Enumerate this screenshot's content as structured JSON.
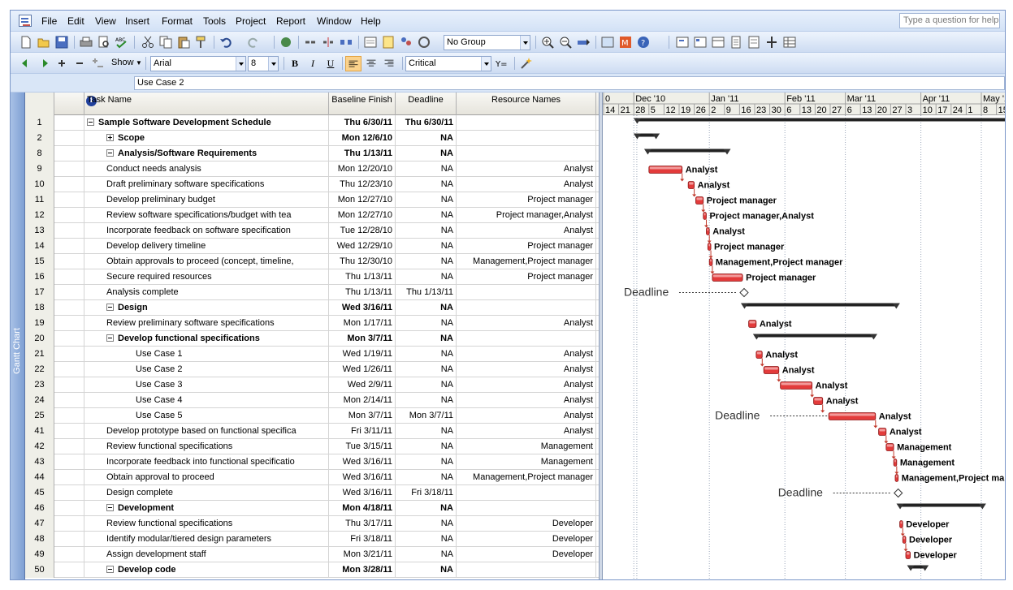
{
  "menu": [
    "File",
    "Edit",
    "View",
    "Insert",
    "Format",
    "Tools",
    "Project",
    "Report",
    "Window",
    "Help"
  ],
  "help_placeholder": "Type a question for help",
  "toolbar1": {
    "group_value": "No Group"
  },
  "toolbar2": {
    "show_label": "Show",
    "font": "Arial",
    "size": "8",
    "bold": "B",
    "italic": "I",
    "underline": "U",
    "filter": "Critical"
  },
  "entry_value": "Use Case 2",
  "view_label": "Gantt Chart",
  "columns": {
    "task_name": "Task Name",
    "baseline_finish": "Baseline Finish",
    "deadline": "Deadline",
    "resource_names": "Resource Names"
  },
  "tasks": [
    {
      "id": "1",
      "name": "Sample Software Development Schedule",
      "baseline": "Thu 6/30/11",
      "deadline": "Thu 6/30/11",
      "resources": "",
      "level": 0,
      "summary": true,
      "toggle": "minus"
    },
    {
      "id": "2",
      "name": "Scope",
      "baseline": "Mon 12/6/10",
      "deadline": "NA",
      "resources": "",
      "level": 1,
      "summary": true,
      "toggle": "plus"
    },
    {
      "id": "8",
      "name": "Analysis/Software Requirements",
      "baseline": "Thu 1/13/11",
      "deadline": "NA",
      "resources": "",
      "level": 1,
      "summary": true,
      "toggle": "minus"
    },
    {
      "id": "9",
      "name": "Conduct needs analysis",
      "baseline": "Mon 12/20/10",
      "deadline": "NA",
      "resources": "Analyst",
      "level": 2,
      "summary": false
    },
    {
      "id": "10",
      "name": "Draft preliminary software specifications",
      "baseline": "Thu 12/23/10",
      "deadline": "NA",
      "resources": "Analyst",
      "level": 2,
      "summary": false
    },
    {
      "id": "11",
      "name": "Develop preliminary budget",
      "baseline": "Mon 12/27/10",
      "deadline": "NA",
      "resources": "Project manager",
      "level": 2,
      "summary": false
    },
    {
      "id": "12",
      "name": "Review software specifications/budget with tea",
      "baseline": "Mon 12/27/10",
      "deadline": "NA",
      "resources": "Project manager,Analyst",
      "level": 2,
      "summary": false
    },
    {
      "id": "13",
      "name": "Incorporate feedback on software specification",
      "baseline": "Tue 12/28/10",
      "deadline": "NA",
      "resources": "Analyst",
      "level": 2,
      "summary": false
    },
    {
      "id": "14",
      "name": "Develop delivery timeline",
      "baseline": "Wed 12/29/10",
      "deadline": "NA",
      "resources": "Project manager",
      "level": 2,
      "summary": false
    },
    {
      "id": "15",
      "name": "Obtain approvals to proceed (concept, timeline,",
      "baseline": "Thu 12/30/10",
      "deadline": "NA",
      "resources": "Management,Project manager",
      "level": 2,
      "summary": false
    },
    {
      "id": "16",
      "name": "Secure required resources",
      "baseline": "Thu 1/13/11",
      "deadline": "NA",
      "resources": "Project manager",
      "level": 2,
      "summary": false
    },
    {
      "id": "17",
      "name": "Analysis complete",
      "baseline": "Thu 1/13/11",
      "deadline": "Thu 1/13/11",
      "resources": "",
      "level": 2,
      "summary": false
    },
    {
      "id": "18",
      "name": "Design",
      "baseline": "Wed 3/16/11",
      "deadline": "NA",
      "resources": "",
      "level": 1,
      "summary": true,
      "toggle": "minus"
    },
    {
      "id": "19",
      "name": "Review preliminary software specifications",
      "baseline": "Mon 1/17/11",
      "deadline": "NA",
      "resources": "Analyst",
      "level": 2,
      "summary": false
    },
    {
      "id": "20",
      "name": "Develop functional specifications",
      "baseline": "Mon 3/7/11",
      "deadline": "NA",
      "resources": "",
      "level": 2,
      "summary": true,
      "toggle": "minus"
    },
    {
      "id": "21",
      "name": "Use Case 1",
      "baseline": "Wed 1/19/11",
      "deadline": "NA",
      "resources": "Analyst",
      "level": 3,
      "summary": false
    },
    {
      "id": "22",
      "name": "Use Case 2",
      "baseline": "Wed 1/26/11",
      "deadline": "NA",
      "resources": "Analyst",
      "level": 3,
      "summary": false
    },
    {
      "id": "23",
      "name": "Use Case 3",
      "baseline": "Wed 2/9/11",
      "deadline": "NA",
      "resources": "Analyst",
      "level": 3,
      "summary": false
    },
    {
      "id": "24",
      "name": "Use Case 4",
      "baseline": "Mon 2/14/11",
      "deadline": "NA",
      "resources": "Analyst",
      "level": 3,
      "summary": false
    },
    {
      "id": "25",
      "name": "Use Case 5",
      "baseline": "Mon 3/7/11",
      "deadline": "Mon 3/7/11",
      "resources": "Analyst",
      "level": 3,
      "summary": false
    },
    {
      "id": "41",
      "name": "Develop prototype based on functional specifica",
      "baseline": "Fri 3/11/11",
      "deadline": "NA",
      "resources": "Analyst",
      "level": 2,
      "summary": false
    },
    {
      "id": "42",
      "name": "Review functional specifications",
      "baseline": "Tue 3/15/11",
      "deadline": "NA",
      "resources": "Management",
      "level": 2,
      "summary": false
    },
    {
      "id": "43",
      "name": "Incorporate feedback into functional specificatio",
      "baseline": "Wed 3/16/11",
      "deadline": "NA",
      "resources": "Management",
      "level": 2,
      "summary": false
    },
    {
      "id": "44",
      "name": "Obtain approval to proceed",
      "baseline": "Wed 3/16/11",
      "deadline": "NA",
      "resources": "Management,Project manager",
      "level": 2,
      "summary": false
    },
    {
      "id": "45",
      "name": "Design complete",
      "baseline": "Wed 3/16/11",
      "deadline": "Fri 3/18/11",
      "resources": "",
      "level": 2,
      "summary": false
    },
    {
      "id": "46",
      "name": "Development",
      "baseline": "Mon 4/18/11",
      "deadline": "NA",
      "resources": "",
      "level": 1,
      "summary": true,
      "toggle": "minus"
    },
    {
      "id": "47",
      "name": "Review functional specifications",
      "baseline": "Thu 3/17/11",
      "deadline": "NA",
      "resources": "Developer",
      "level": 2,
      "summary": false
    },
    {
      "id": "48",
      "name": "Identify modular/tiered design parameters",
      "baseline": "Fri 3/18/11",
      "deadline": "NA",
      "resources": "Developer",
      "level": 2,
      "summary": false
    },
    {
      "id": "49",
      "name": "Assign development staff",
      "baseline": "Mon 3/21/11",
      "deadline": "NA",
      "resources": "Developer",
      "level": 2,
      "summary": false
    },
    {
      "id": "50",
      "name": "Develop code",
      "baseline": "Mon 3/28/11",
      "deadline": "NA",
      "resources": "",
      "level": 2,
      "summary": true,
      "toggle": "minus"
    }
  ],
  "timescale": {
    "months": [
      {
        "label": "0",
        "week_index": 0
      },
      {
        "label": "Dec '10",
        "week_index": 2
      },
      {
        "label": "Jan '11",
        "week_index": 7
      },
      {
        "label": "Feb '11",
        "week_index": 12
      },
      {
        "label": "Mar '11",
        "week_index": 16
      },
      {
        "label": "Apr '11",
        "week_index": 21
      },
      {
        "label": "May '11",
        "week_index": 25
      }
    ],
    "days": [
      "14",
      "21",
      "28",
      "5",
      "12",
      "19",
      "26",
      "2",
      "9",
      "16",
      "23",
      "30",
      "6",
      "13",
      "20",
      "27",
      "6",
      "13",
      "20",
      "27",
      "3",
      "10",
      "17",
      "24",
      "1",
      "8",
      "15"
    ]
  },
  "gantt_bars": [
    {
      "row": 0,
      "type": "summary",
      "start": 2.2,
      "end": 32
    },
    {
      "row": 1,
      "type": "summary",
      "start": 2.2,
      "end": 3.5
    },
    {
      "row": 2,
      "type": "summary",
      "start": 2.9,
      "end": 8.2
    },
    {
      "row": 3,
      "type": "task",
      "start": 3.0,
      "end": 5.2,
      "label": "Analyst"
    },
    {
      "row": 4,
      "type": "task",
      "start": 5.6,
      "end": 6.0,
      "label": "Analyst"
    },
    {
      "row": 5,
      "type": "task",
      "start": 6.1,
      "end": 6.6,
      "label": "Project manager"
    },
    {
      "row": 6,
      "type": "task",
      "start": 6.6,
      "end": 6.8,
      "label": "Project manager,Analyst"
    },
    {
      "row": 7,
      "type": "task",
      "start": 6.8,
      "end": 7.0,
      "label": "Analyst"
    },
    {
      "row": 8,
      "type": "task",
      "start": 6.9,
      "end": 7.1,
      "label": "Project manager"
    },
    {
      "row": 9,
      "type": "task",
      "start": 7.0,
      "end": 7.2,
      "label": "Management,Project manager"
    },
    {
      "row": 10,
      "type": "task",
      "start": 7.2,
      "end": 9.2,
      "label": "Project manager"
    },
    {
      "row": 11,
      "type": "milestone",
      "start": 9.3,
      "end": 9.3,
      "label": "",
      "deadline_label": "Deadline"
    },
    {
      "row": 12,
      "type": "summary",
      "start": 9.3,
      "end": 19.4
    },
    {
      "row": 13,
      "type": "task",
      "start": 9.6,
      "end": 10.1,
      "label": "Analyst"
    },
    {
      "row": 14,
      "type": "summary",
      "start": 10.1,
      "end": 17.9
    },
    {
      "row": 15,
      "type": "task",
      "start": 10.1,
      "end": 10.5,
      "label": "Analyst"
    },
    {
      "row": 16,
      "type": "task",
      "start": 10.6,
      "end": 11.6,
      "label": "Analyst"
    },
    {
      "row": 17,
      "type": "task",
      "start": 11.7,
      "end": 13.8,
      "label": "Analyst"
    },
    {
      "row": 18,
      "type": "task",
      "start": 13.9,
      "end": 14.5,
      "label": "Analyst"
    },
    {
      "row": 19,
      "type": "task",
      "start": 14.9,
      "end": 18.0,
      "label": "Analyst",
      "deadline_label": "Deadline"
    },
    {
      "row": 20,
      "type": "task",
      "start": 18.2,
      "end": 18.7,
      "label": "Analyst"
    },
    {
      "row": 21,
      "type": "task",
      "start": 18.7,
      "end": 19.2,
      "label": "Management"
    },
    {
      "row": 22,
      "type": "task",
      "start": 19.2,
      "end": 19.4,
      "label": "Management"
    },
    {
      "row": 23,
      "type": "task",
      "start": 19.3,
      "end": 19.5,
      "label": "Management,Project manager"
    },
    {
      "row": 24,
      "type": "milestone",
      "start": 19.5,
      "end": 19.5,
      "label": "",
      "deadline_label": "Deadline"
    },
    {
      "row": 25,
      "type": "summary",
      "start": 19.6,
      "end": 25.1
    },
    {
      "row": 26,
      "type": "task",
      "start": 19.6,
      "end": 19.8,
      "label": "Developer"
    },
    {
      "row": 27,
      "type": "task",
      "start": 19.8,
      "end": 20.0,
      "label": "Developer"
    },
    {
      "row": 28,
      "type": "task",
      "start": 20.0,
      "end": 20.3,
      "label": "Developer"
    },
    {
      "row": 29,
      "type": "summary",
      "start": 20.3,
      "end": 21.3
    }
  ],
  "colors": {
    "bar_red": "#e33b3b",
    "summary_black": "#222222",
    "chrome_blue": "#d9e6f7"
  }
}
